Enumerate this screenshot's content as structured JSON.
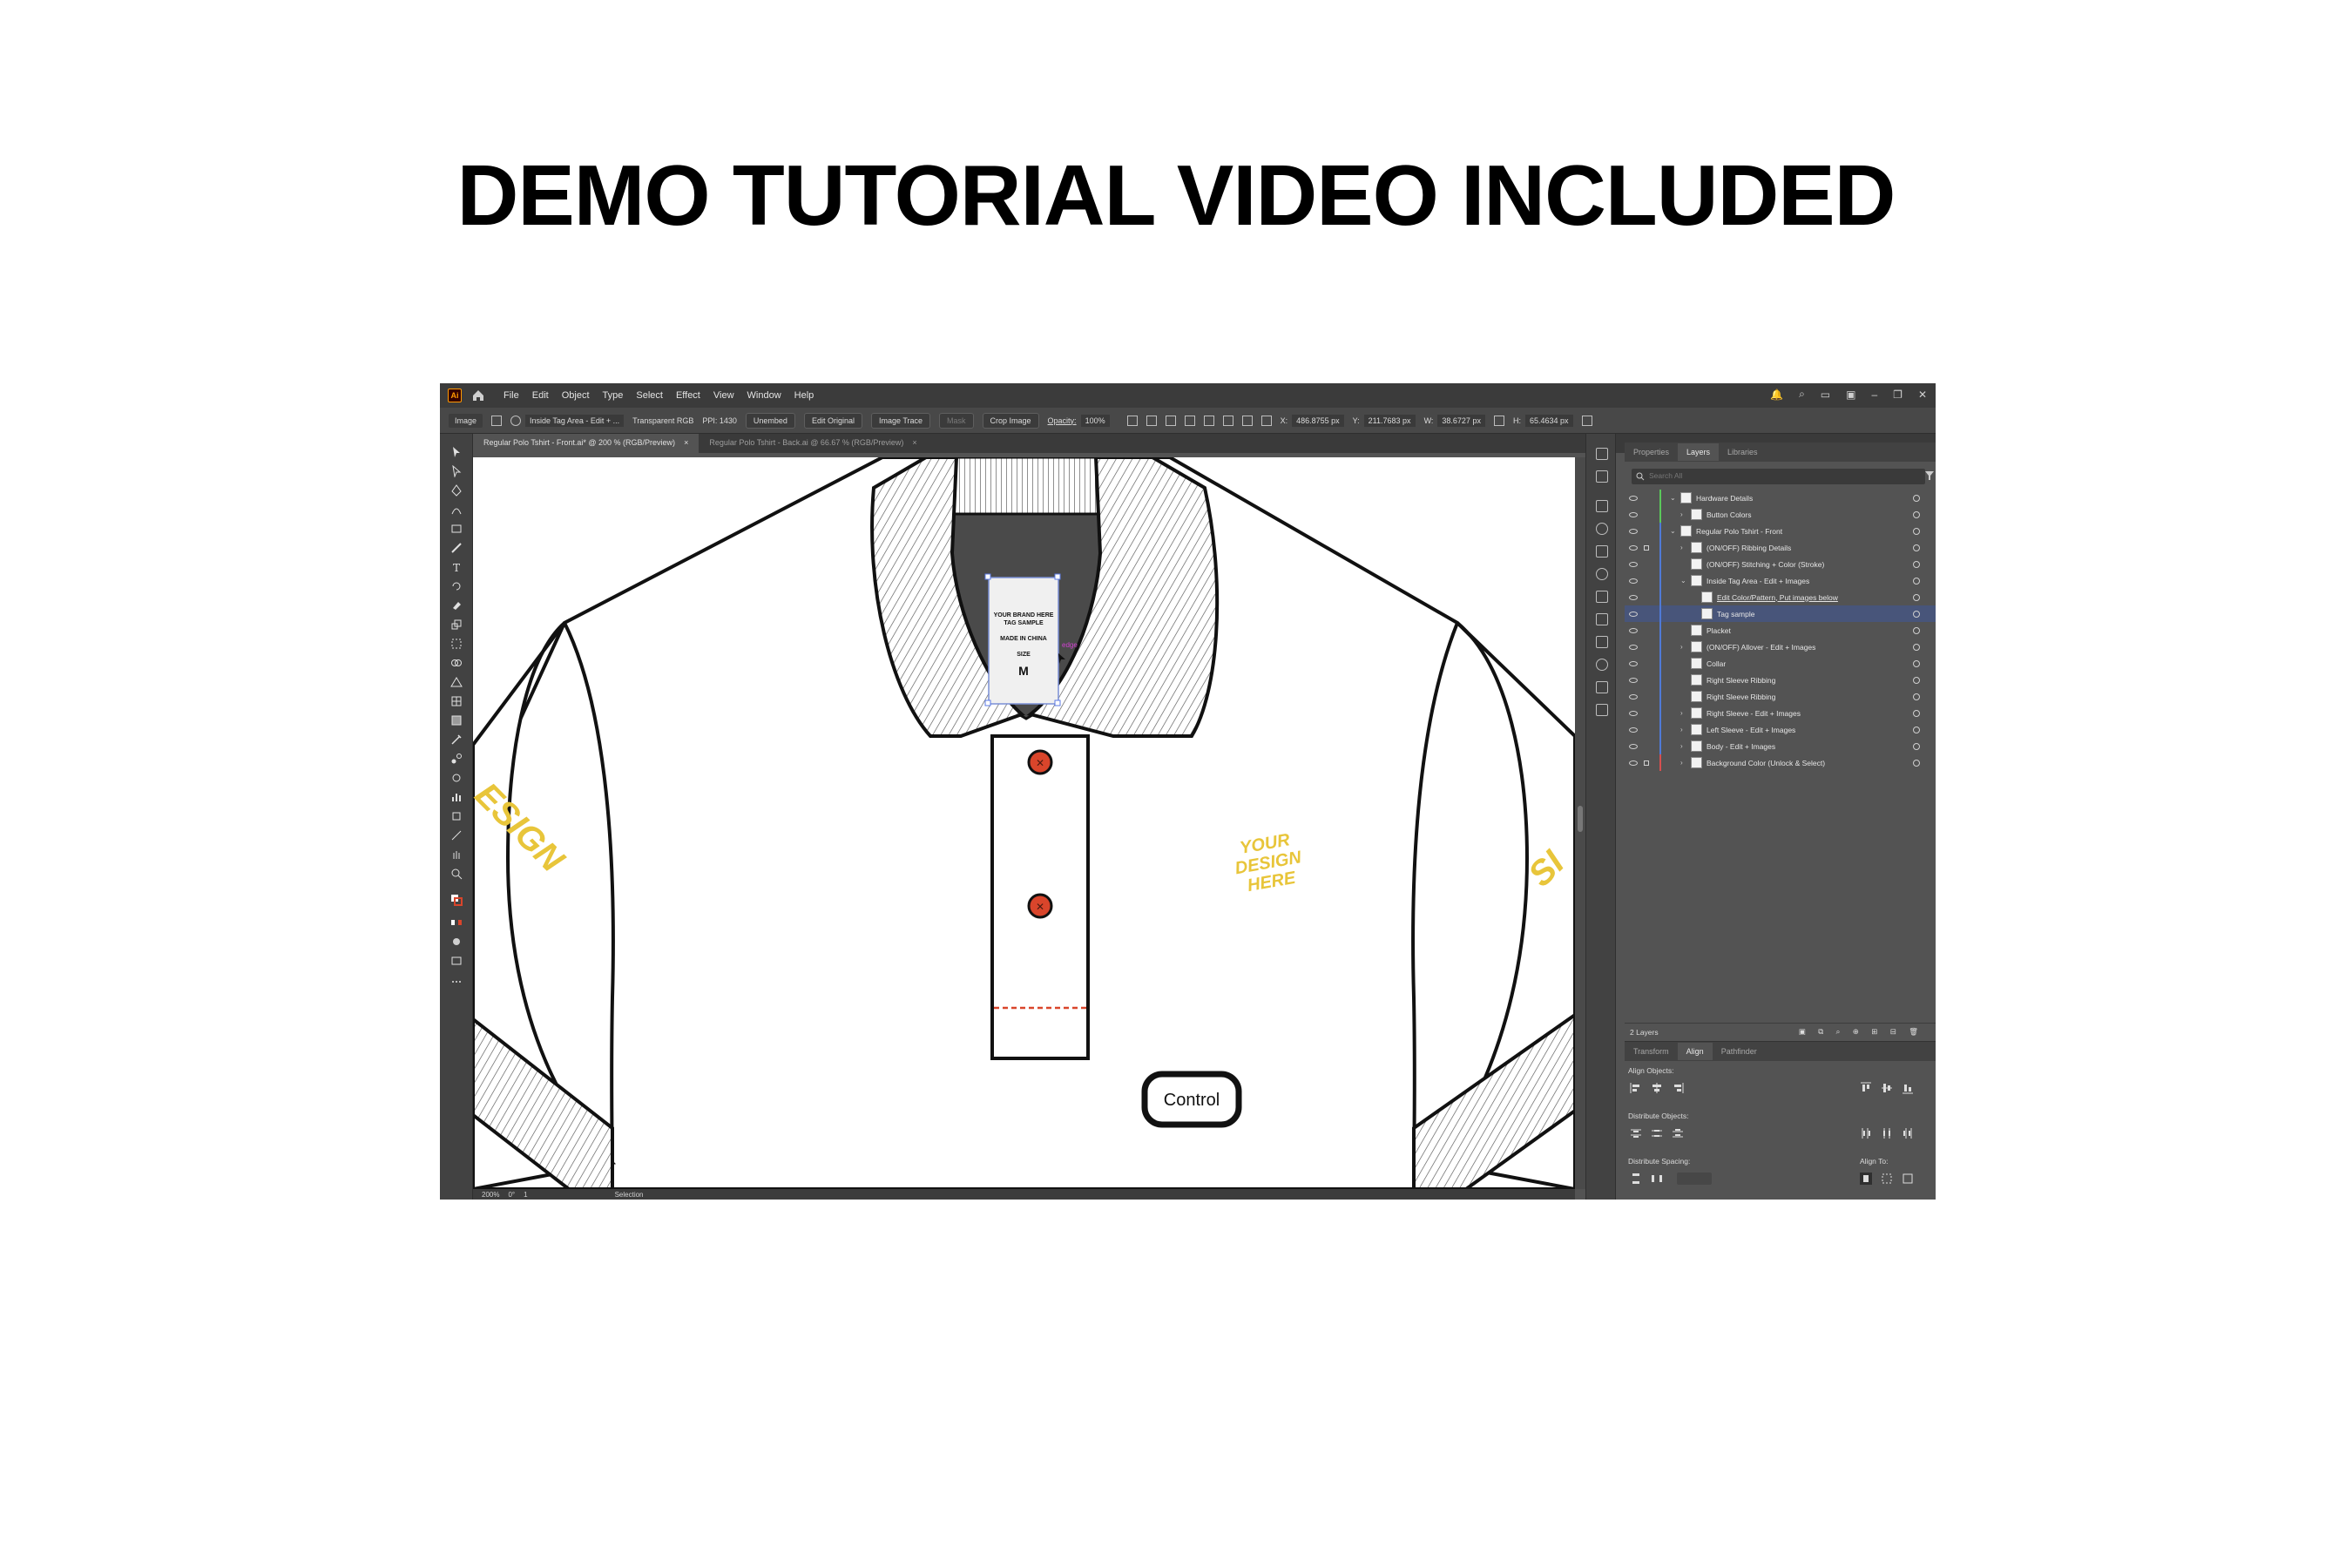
{
  "headline": "DEMO TUTORIAL VIDEO INCLUDED",
  "menu": [
    "File",
    "Edit",
    "Object",
    "Type",
    "Select",
    "Effect",
    "View",
    "Window",
    "Help"
  ],
  "control_bar": {
    "object_type": "Image",
    "layer_name": "Inside Tag Area - Edit + ...",
    "color_mode": "Transparent RGB",
    "ppi": "PPI: 1430",
    "unembed": "Unembed",
    "edit_original": "Edit Original",
    "image_trace": "Image Trace",
    "mask": "Mask",
    "crop_image": "Crop Image",
    "opacity_label": "Opacity:",
    "opacity_value": "100%",
    "x_label": "X:",
    "x_value": "486.8755 px",
    "y_label": "Y:",
    "y_value": "211.7683 px",
    "w_label": "W:",
    "w_value": "38.6727 px",
    "h_label": "H:",
    "h_value": "65.4634 px"
  },
  "tabs": [
    {
      "label": "Regular Polo Tshirt - Front.ai* @ 200 % (RGB/Preview)",
      "close": "×"
    },
    {
      "label": "Regular Polo Tshirt - Back.ai @ 66.67 % (RGB/Preview)",
      "close": "×"
    }
  ],
  "canvas": {
    "tag_lines": [
      "YOUR BRAND HERE",
      "TAG SAMPLE",
      "MADE IN CHINA",
      "SIZE",
      "M"
    ],
    "edge_hint": "edge",
    "sleeve_left_text": "ESIGN",
    "sleeve_right_text": "SI",
    "chest_text": [
      "YOUR",
      "DESIGN",
      "HERE"
    ],
    "key_badge": "Control",
    "colors": {
      "design_yellow": "#e8c53a",
      "button_red": "#d9452b",
      "collar_dark": "#4a4a4a"
    }
  },
  "status": {
    "zoom": "200%",
    "rotation": "0°",
    "artboard": "1",
    "tool": "Selection"
  },
  "layers_panel": {
    "tabs": [
      "Properties",
      "Layers",
      "Libraries"
    ],
    "search_placeholder": "Search All",
    "rows": [
      {
        "name": "Hardware Details",
        "indent": 0,
        "chevron": "⌄",
        "color": "#5ac85a",
        "lock": false,
        "link": false
      },
      {
        "name": "Button Colors",
        "indent": 1,
        "chevron": "›",
        "color": "#5ac85a",
        "lock": false,
        "link": false
      },
      {
        "name": "Regular Polo Tshirt - Front",
        "indent": 0,
        "chevron": "⌄",
        "color": "#4f7ad6",
        "lock": false,
        "link": false
      },
      {
        "name": "(ON/OFF) Ribbing Details",
        "indent": 1,
        "chevron": "›",
        "color": "#4f7ad6",
        "lock": true,
        "link": false
      },
      {
        "name": "(ON/OFF) Stitching + Color (Stroke)",
        "indent": 1,
        "chevron": "",
        "color": "#4f7ad6",
        "lock": false,
        "link": false
      },
      {
        "name": "Inside Tag Area - Edit + Images",
        "indent": 1,
        "chevron": "⌄",
        "color": "#4f7ad6",
        "lock": false,
        "link": false
      },
      {
        "name": "Edit Color/Pattern, Put images below",
        "indent": 2,
        "chevron": "",
        "color": "#4f7ad6",
        "lock": false,
        "link": true
      },
      {
        "name": "Tag sample",
        "indent": 2,
        "chevron": "",
        "color": "#4f7ad6",
        "lock": false,
        "link": false
      },
      {
        "name": "Placket",
        "indent": 1,
        "chevron": "",
        "color": "#4f7ad6",
        "lock": false,
        "link": false
      },
      {
        "name": "(ON/OFF) Allover - Edit + Images",
        "indent": 1,
        "chevron": "›",
        "color": "#4f7ad6",
        "lock": false,
        "link": false
      },
      {
        "name": "Collar",
        "indent": 1,
        "chevron": "",
        "color": "#4f7ad6",
        "lock": false,
        "link": false
      },
      {
        "name": "Right Sleeve Ribbing",
        "indent": 1,
        "chevron": "",
        "color": "#4f7ad6",
        "lock": false,
        "link": false
      },
      {
        "name": "Right Sleeve Ribbing",
        "indent": 1,
        "chevron": "",
        "color": "#4f7ad6",
        "lock": false,
        "link": false
      },
      {
        "name": "Right Sleeve - Edit + Images",
        "indent": 1,
        "chevron": "›",
        "color": "#4f7ad6",
        "lock": false,
        "link": false
      },
      {
        "name": "Left Sleeve - Edit + Images",
        "indent": 1,
        "chevron": "›",
        "color": "#4f7ad6",
        "lock": false,
        "link": false
      },
      {
        "name": "Body - Edit + Images",
        "indent": 1,
        "chevron": "›",
        "color": "#4f7ad6",
        "lock": false,
        "link": false
      },
      {
        "name": "Background Color (Unlock & Select)",
        "indent": 1,
        "chevron": "›",
        "color": "#d64f4f",
        "lock": true,
        "link": false
      }
    ],
    "footer": "2 Layers"
  },
  "align_panel": {
    "tabs": [
      "Transform",
      "Align",
      "Pathfinder"
    ],
    "align_objects": "Align Objects:",
    "distribute_objects": "Distribute Objects:",
    "distribute_spacing": "Distribute Spacing:",
    "align_to": "Align To:"
  }
}
